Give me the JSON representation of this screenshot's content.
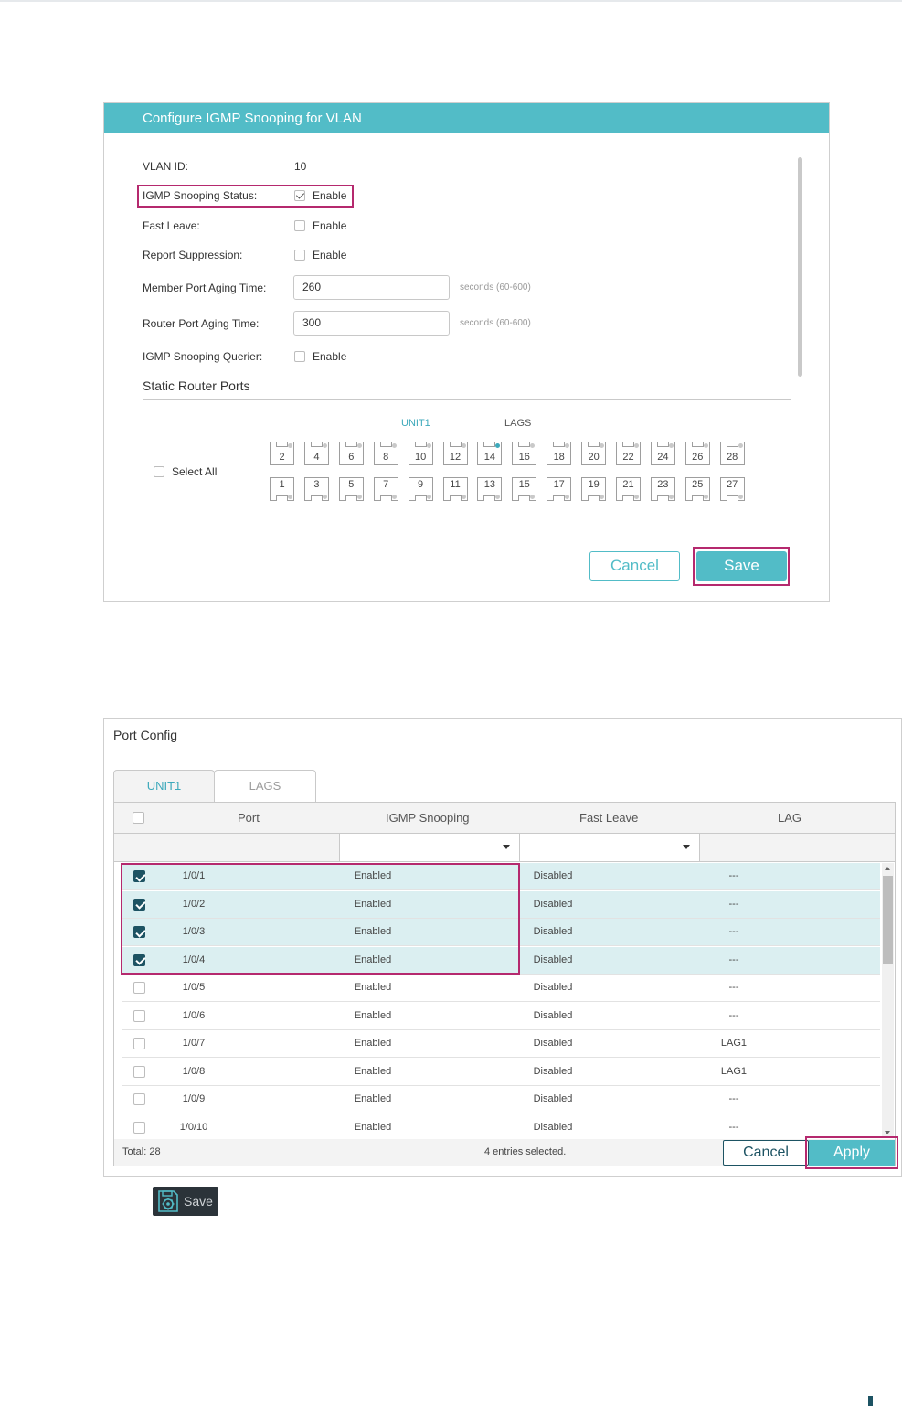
{
  "configure": {
    "title": "Configure IGMP Snooping for VLAN",
    "vlan_id_label": "VLAN ID:",
    "vlan_id_value": "10",
    "status_label": "IGMP Snooping Status:",
    "status_enable": "Enable",
    "fast_leave_label": "Fast Leave:",
    "fast_leave_enable": "Enable",
    "report_label": "Report Suppression:",
    "report_enable": "Enable",
    "member_label": "Member Port Aging Time:",
    "member_value": "260",
    "member_hint": "seconds (60-600)",
    "router_label": "Router Port Aging Time:",
    "router_value": "300",
    "router_hint": "seconds (60-600)",
    "querier_label": "IGMP Snooping Querier:",
    "querier_enable": "Enable",
    "static_section": "Static Router Ports",
    "tab_unit": "UNIT1",
    "tab_lags": "LAGS",
    "select_all": "Select All",
    "top_ports": [
      "2",
      "4",
      "6",
      "8",
      "10",
      "12",
      "14",
      "16",
      "18",
      "20",
      "22",
      "24",
      "26",
      "28"
    ],
    "bottom_ports": [
      "1",
      "3",
      "5",
      "7",
      "9",
      "11",
      "13",
      "15",
      "17",
      "19",
      "21",
      "23",
      "25",
      "27"
    ],
    "cancel": "Cancel",
    "save": "Save"
  },
  "port_config": {
    "title": "Port Config",
    "tabs": [
      "UNIT1",
      "LAGS"
    ],
    "headers": [
      "Port",
      "IGMP Snooping",
      "Fast Leave",
      "LAG"
    ],
    "rows": [
      {
        "port": "1/0/1",
        "igmp": "Enabled",
        "fast": "Disabled",
        "lag": "---",
        "checked": true
      },
      {
        "port": "1/0/2",
        "igmp": "Enabled",
        "fast": "Disabled",
        "lag": "---",
        "checked": true
      },
      {
        "port": "1/0/3",
        "igmp": "Enabled",
        "fast": "Disabled",
        "lag": "---",
        "checked": true
      },
      {
        "port": "1/0/4",
        "igmp": "Enabled",
        "fast": "Disabled",
        "lag": "---",
        "checked": true
      },
      {
        "port": "1/0/5",
        "igmp": "Enabled",
        "fast": "Disabled",
        "lag": "---",
        "checked": false
      },
      {
        "port": "1/0/6",
        "igmp": "Enabled",
        "fast": "Disabled",
        "lag": "---",
        "checked": false
      },
      {
        "port": "1/0/7",
        "igmp": "Enabled",
        "fast": "Disabled",
        "lag": "LAG1",
        "checked": false
      },
      {
        "port": "1/0/8",
        "igmp": "Enabled",
        "fast": "Disabled",
        "lag": "LAG1",
        "checked": false
      },
      {
        "port": "1/0/9",
        "igmp": "Enabled",
        "fast": "Disabled",
        "lag": "---",
        "checked": false
      },
      {
        "port": "1/0/10",
        "igmp": "Enabled",
        "fast": "Disabled",
        "lag": "---",
        "checked": false
      }
    ],
    "total": "Total: 28",
    "selected": "4 entries selected.",
    "cancel": "Cancel",
    "apply": "Apply"
  },
  "save_button": {
    "label": "Save",
    "icon": "save-gear-icon"
  },
  "colors": {
    "accent": "#52bcc7",
    "highlight": "#b5296e",
    "dark": "#1d5363",
    "selected_row": "#dbeff1"
  }
}
